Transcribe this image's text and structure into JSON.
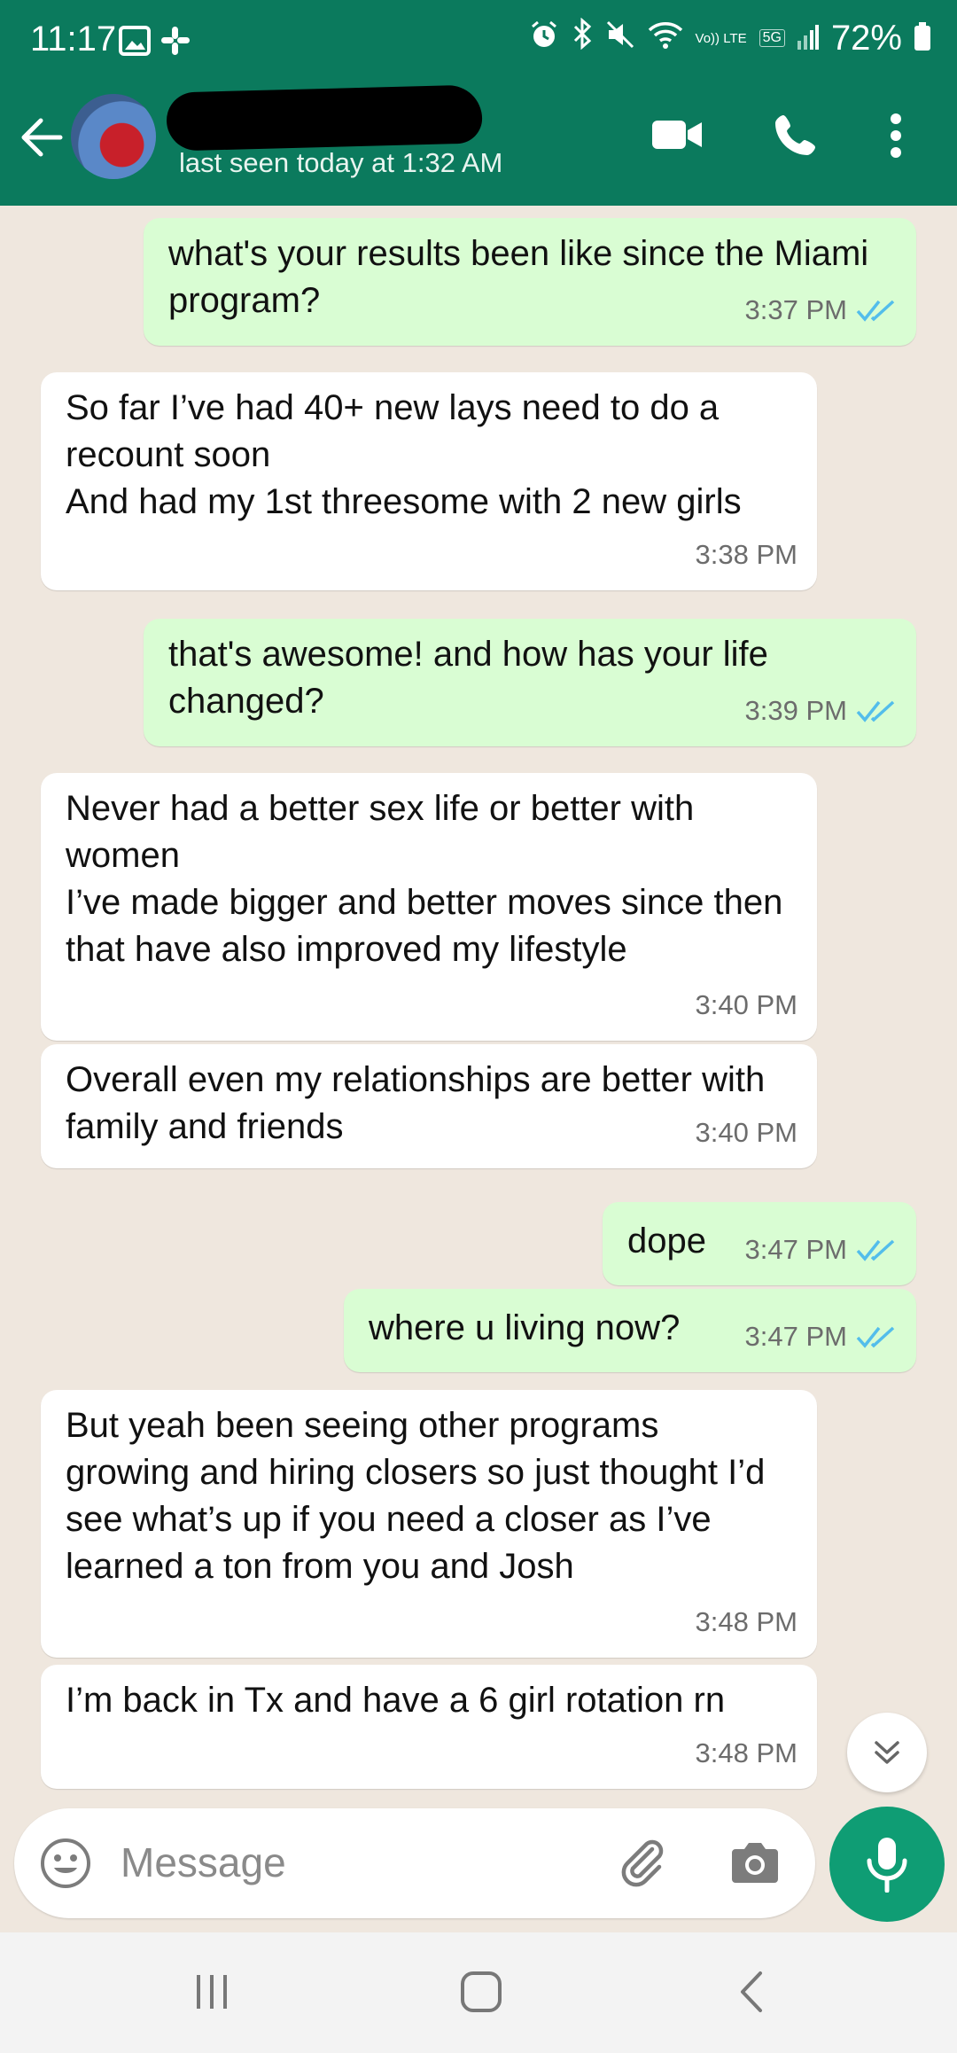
{
  "status_bar": {
    "time": "11:17",
    "lte": "Vo)) LTE",
    "net": "5G",
    "battery": "72%"
  },
  "header": {
    "contact_name": "",
    "last_seen": "last seen today at 1:32 AM"
  },
  "messages": [
    {
      "direction": "out",
      "text": "what's your results been like since the Miami program?",
      "time": "3:37 PM",
      "read": true
    },
    {
      "direction": "in",
      "text": "So far I’ve had 40+ new lays need to do a recount soon\nAnd had my 1st threesome with 2 new girls",
      "time": "3:38 PM"
    },
    {
      "direction": "out",
      "text": "that's awesome! and how has your life changed?",
      "time": "3:39 PM",
      "read": true
    },
    {
      "direction": "in",
      "text": "Never had a better sex life or better with women\nI’ve made bigger and better moves since then that have also improved my lifestyle",
      "time": "3:40 PM"
    },
    {
      "direction": "in",
      "text": "Overall even my relationships are better with family and friends",
      "time": "3:40 PM"
    },
    {
      "direction": "out",
      "text": "dope",
      "time": "3:47 PM",
      "read": true
    },
    {
      "direction": "out",
      "text": "where u living now?",
      "time": "3:47 PM",
      "read": true
    },
    {
      "direction": "in",
      "text": "But yeah been seeing other programs growing and hiring closers so just thought I’d see what’s up if you need a closer as I’ve learned a ton from you and Josh",
      "time": "3:48 PM"
    },
    {
      "direction": "in",
      "text": "I’m back in Tx and have a 6 girl rotation rn",
      "time": "3:48 PM"
    }
  ],
  "composer": {
    "placeholder": "Message"
  },
  "colors": {
    "header": "#0b7a5d",
    "outgoing_bubble": "#d9fdd3",
    "incoming_bubble": "#ffffff",
    "chat_background": "#efe7de",
    "read_ticks": "#53bdeb",
    "mic_button": "#0f9d74"
  },
  "icons": [
    "gallery-icon",
    "slack-icon",
    "alarm-icon",
    "bluetooth-icon",
    "mute-icon",
    "wifi-icon",
    "signal-icon",
    "battery-icon",
    "back-arrow-icon",
    "video-call-icon",
    "voice-call-icon",
    "more-options-icon",
    "double-check-icon",
    "scroll-down-icon",
    "emoji-icon",
    "attach-icon",
    "camera-icon",
    "mic-icon",
    "recent-apps-icon",
    "home-icon",
    "nav-back-icon"
  ]
}
